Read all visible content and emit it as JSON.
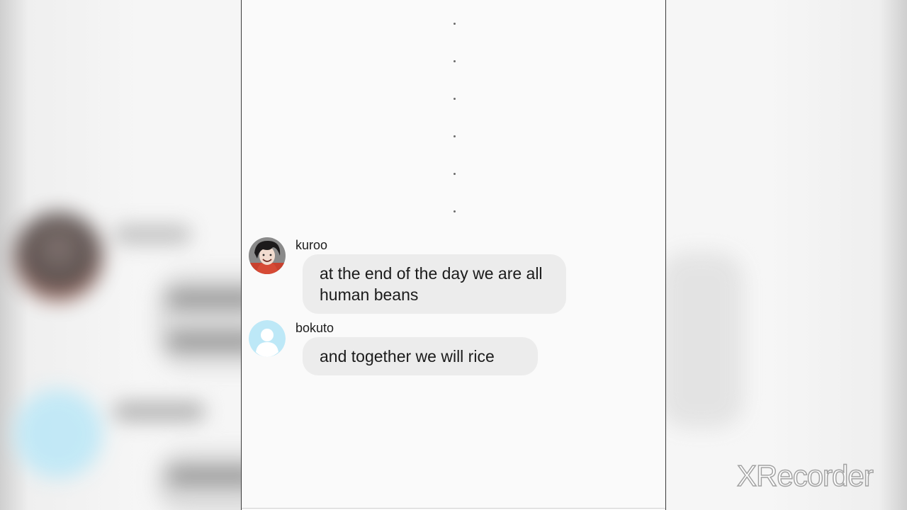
{
  "chat": {
    "messages": [
      {
        "sender": "kuroo",
        "avatar": "kuroo-avatar",
        "text": "at the end of the day we are all human beans"
      },
      {
        "sender": "bokuto",
        "avatar": "default-user-avatar",
        "text": "and together we will rice"
      }
    ]
  },
  "watermark": {
    "text": "XRecorder"
  },
  "colors": {
    "bubble": "#ececec",
    "screen_bg": "#fafafa",
    "default_avatar": "#bde8f7"
  }
}
